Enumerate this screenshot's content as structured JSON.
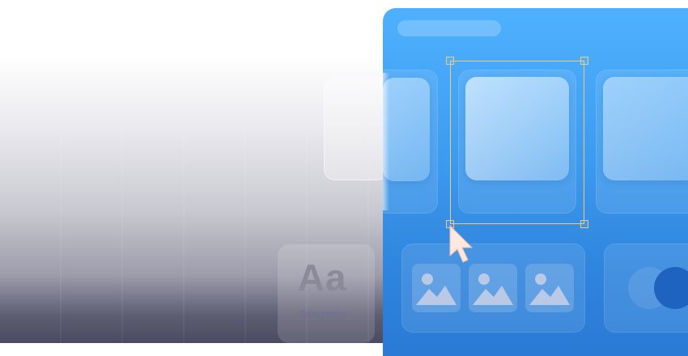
{
  "typography_card": {
    "sample": "Aa",
    "label": "Typography"
  },
  "colors": {
    "panel_accent": "#3f9df0",
    "selection_outline": "#f0c97a",
    "cursor": "#ffffff"
  },
  "icons": {
    "image_placeholder": "image-icon",
    "pointer": "cursor-arrow-icon"
  }
}
